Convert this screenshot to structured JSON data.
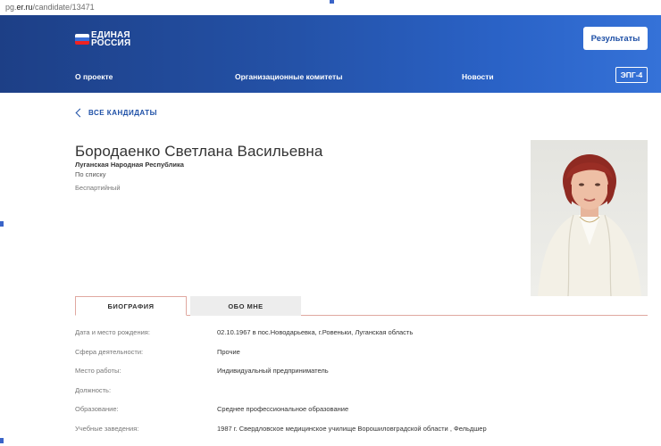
{
  "browser": {
    "url_prefix": "pg.",
    "url_domain": "er.ru",
    "url_path": "/candidate/13471"
  },
  "header": {
    "logo_line1": "ЕДИНАЯ",
    "logo_line2": "РОССИЯ",
    "results_button": "Результаты",
    "nav": [
      "О проекте",
      "Организационные комитеты",
      "Новости"
    ],
    "epg_button": "ЭПГ-4",
    "colors": {
      "gradient_start": "#1d3f86",
      "gradient_end": "#3572d8",
      "accent": "#1d4fa6"
    }
  },
  "back_link": "ВСЕ КАНДИДАТЫ",
  "candidate": {
    "name": "Бородаенко Светлана Васильевна",
    "region": "Луганская Народная Республика",
    "list_type": "По списку",
    "party_status": "Беспартийный"
  },
  "tabs": [
    {
      "label": "БИОГРАФИЯ",
      "active": true
    },
    {
      "label": "ОБО МНЕ",
      "active": false
    }
  ],
  "biography": [
    {
      "label": "Дата и место рождения:",
      "value": "02.10.1967 в пос.Новодарьевка, г.Ровеньки, Луганская область"
    },
    {
      "label": "Сфера деятельности:",
      "value": "Прочие"
    },
    {
      "label": "Место работы:",
      "value": "Индивидуальный предприниматель"
    },
    {
      "label": "Должность:",
      "value": ""
    },
    {
      "label": "Образование:",
      "value": "Среднее профессиональное образование"
    },
    {
      "label": "Учебные заведения:",
      "value": "1987 г. Свердловское медицинское училище Ворошиловградской области , Фельдшер"
    }
  ]
}
